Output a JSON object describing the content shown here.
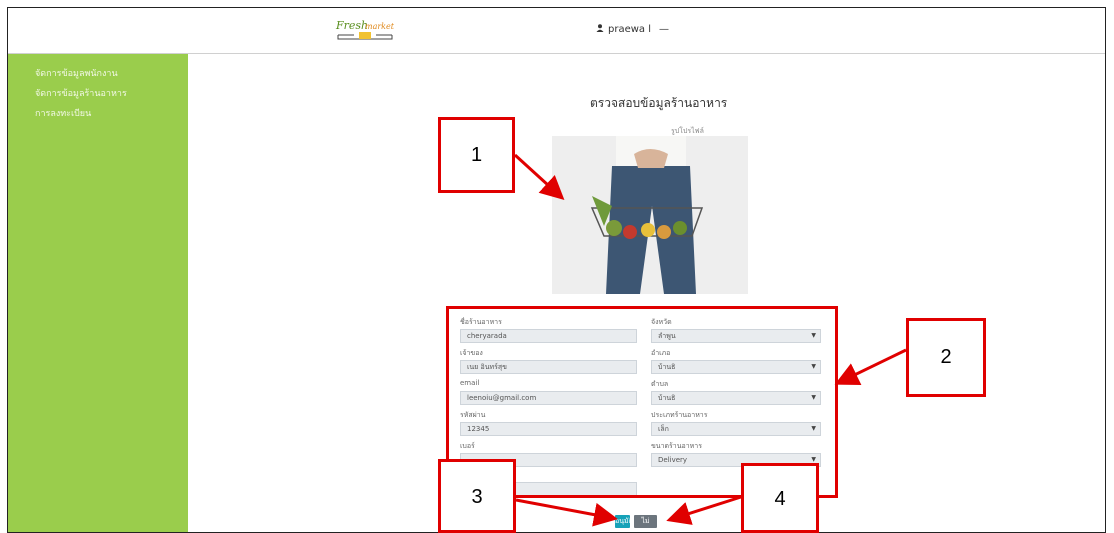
{
  "header": {
    "logo_text": "Fresh market",
    "username": "praewa l",
    "menu_glyph": "—"
  },
  "sidebar": {
    "items": [
      {
        "label": "จัดการข้อมูลพนักงาน"
      },
      {
        "label": "จัดการข้อมูลร้านอาหาร"
      },
      {
        "label": "การลงทะเบียน"
      }
    ]
  },
  "main": {
    "title": "ตรวจสอบข้อมูลร้านอาหาร",
    "image_label": "รูปโปรไฟล์",
    "left_fields": [
      {
        "label": "ชื่อร้านอาหาร",
        "value": "cheryarada"
      },
      {
        "label": "เจ้าของ",
        "value": "เนย อินทร์สุข"
      },
      {
        "label": "email",
        "value": "leenoiu@gmail.com"
      },
      {
        "label": "รหัสผ่าน",
        "value": "12345"
      },
      {
        "label": "เบอร์",
        "value": ""
      },
      {
        "label": "",
        "value": ""
      }
    ],
    "right_fields": [
      {
        "label": "จังหวัด",
        "value": "ลำพูน"
      },
      {
        "label": "อำเภอ",
        "value": "บ้านธิ"
      },
      {
        "label": "ตำบล",
        "value": "บ้านธิ"
      },
      {
        "label": "ประเภทร้านอาหาร",
        "value": "เล็ก"
      },
      {
        "label": "ขนาดร้านอาหาร",
        "value": "Delivery"
      }
    ],
    "approve_label": "อนุมัติ",
    "reject_label": "ไม่อนุมัติ"
  },
  "annotations": [
    "1",
    "2",
    "3",
    "4"
  ],
  "colors": {
    "sidebar": "#9acd4c",
    "annotation": "#e00000",
    "approve": "#17a2b8",
    "reject": "#6c757d"
  },
  "icons": [
    "user-icon",
    "caret-down-icon"
  ]
}
